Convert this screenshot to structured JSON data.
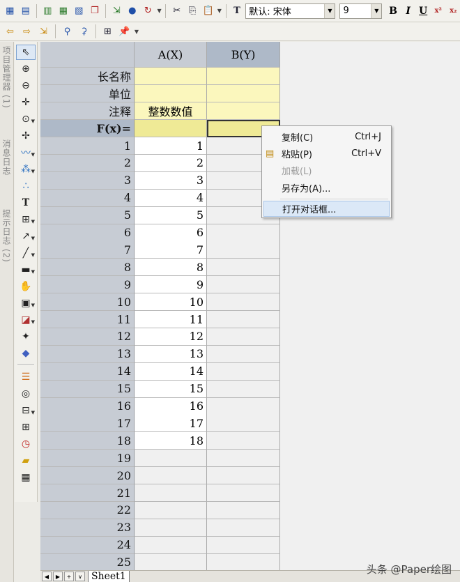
{
  "toolbar": {
    "font_name": "默认: 宋体",
    "font_size": "9",
    "bold": "B",
    "italic": "I",
    "underline": "U",
    "sup": "x²",
    "sub": "x₂"
  },
  "side_tabs": [
    "项目管理器 (1)",
    "消息日志",
    "提示日志 (2)"
  ],
  "sheet": {
    "columns": [
      {
        "label": "A(X)",
        "selected": false
      },
      {
        "label": "B(Y)",
        "selected": true
      }
    ],
    "meta_rows": [
      {
        "label": "长名称",
        "a": "",
        "b": ""
      },
      {
        "label": "单位",
        "a": "",
        "b": ""
      },
      {
        "label": "注释",
        "a": "整数数值",
        "b": ""
      },
      {
        "label": "F(x)=",
        "a": "",
        "b": ""
      }
    ],
    "row_numbers": [
      "1",
      "2",
      "3",
      "4",
      "5",
      "6",
      "7",
      "8",
      "9",
      "10",
      "11",
      "12",
      "13",
      "14",
      "15",
      "16",
      "17",
      "18",
      "19",
      "20",
      "21",
      "22",
      "23",
      "24",
      "25"
    ],
    "col_a": [
      "1",
      "2",
      "3",
      "4",
      "5",
      "6",
      "7",
      "8",
      "9",
      "10",
      "11",
      "12",
      "13",
      "14",
      "15",
      "16",
      "17",
      "18"
    ],
    "tab_name": "Sheet1"
  },
  "context_menu": [
    {
      "label": "复制(C)",
      "shortcut": "Ctrl+J",
      "disabled": false
    },
    {
      "label": "粘贴(P)",
      "shortcut": "Ctrl+V",
      "disabled": false
    },
    {
      "label": "加载(L)",
      "shortcut": "",
      "disabled": true
    },
    {
      "label": "另存为(A)...",
      "shortcut": "",
      "disabled": false
    },
    {
      "label": "打开对话框...",
      "shortcut": "",
      "disabled": false,
      "highlighted": true
    }
  ],
  "watermark": "头条 @Paper绘图",
  "colors": {
    "meta_fill": "#fbf7bd",
    "fx_fill": "#efea96",
    "header_fill": "#c7ccd4",
    "menu_highlight": "#dbe8f7"
  }
}
